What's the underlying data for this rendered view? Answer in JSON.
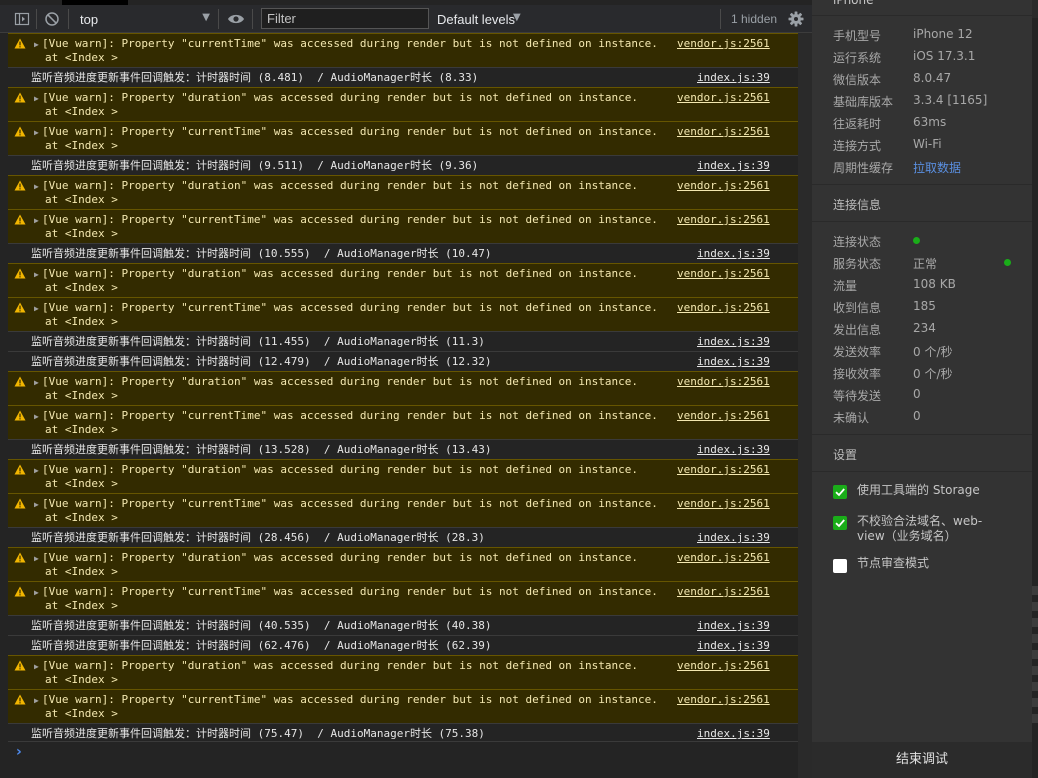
{
  "toolbar": {
    "context": "top",
    "filter_placeholder": "Filter",
    "levels": "Default levels",
    "hidden_count": "1 hidden"
  },
  "logs": [
    {
      "type": "warn",
      "l1": "[Vue warn]: Property \"currentTime\" was accessed during render but is not defined on instance.",
      "l2": "at <Index >",
      "src": "vendor.js:2561"
    },
    {
      "type": "info",
      "msg": "监听音频进度更新事件回调触发：计时器时间 (8.481)  / AudioManager时长 (8.33)",
      "src": "index.js:39"
    },
    {
      "type": "warn",
      "l1": "[Vue warn]: Property \"duration\" was accessed during render but is not defined on instance.",
      "l2": "at <Index >",
      "src": "vendor.js:2561"
    },
    {
      "type": "warn",
      "l1": "[Vue warn]: Property \"currentTime\" was accessed during render but is not defined on instance.",
      "l2": "at <Index >",
      "src": "vendor.js:2561"
    },
    {
      "type": "info",
      "msg": "监听音频进度更新事件回调触发：计时器时间 (9.511)  / AudioManager时长 (9.36)",
      "src": "index.js:39"
    },
    {
      "type": "warn",
      "l1": "[Vue warn]: Property \"duration\" was accessed during render but is not defined on instance.",
      "l2": "at <Index >",
      "src": "vendor.js:2561"
    },
    {
      "type": "warn",
      "l1": "[Vue warn]: Property \"currentTime\" was accessed during render but is not defined on instance.",
      "l2": "at <Index >",
      "src": "vendor.js:2561"
    },
    {
      "type": "info",
      "msg": "监听音频进度更新事件回调触发：计时器时间 (10.555)  / AudioManager时长 (10.47)",
      "src": "index.js:39"
    },
    {
      "type": "warn",
      "l1": "[Vue warn]: Property \"duration\" was accessed during render but is not defined on instance.",
      "l2": "at <Index >",
      "src": "vendor.js:2561"
    },
    {
      "type": "warn",
      "l1": "[Vue warn]: Property \"currentTime\" was accessed during render but is not defined on instance.",
      "l2": "at <Index >",
      "src": "vendor.js:2561"
    },
    {
      "type": "info",
      "msg": "监听音频进度更新事件回调触发：计时器时间 (11.455)  / AudioManager时长 (11.3)",
      "src": "index.js:39"
    },
    {
      "type": "info",
      "msg": "监听音频进度更新事件回调触发：计时器时间 (12.479)  / AudioManager时长 (12.32)",
      "src": "index.js:39"
    },
    {
      "type": "warn",
      "l1": "[Vue warn]: Property \"duration\" was accessed during render but is not defined on instance.",
      "l2": "at <Index >",
      "src": "vendor.js:2561"
    },
    {
      "type": "warn",
      "l1": "[Vue warn]: Property \"currentTime\" was accessed during render but is not defined on instance.",
      "l2": "at <Index >",
      "src": "vendor.js:2561"
    },
    {
      "type": "info",
      "msg": "监听音频进度更新事件回调触发：计时器时间 (13.528)  / AudioManager时长 (13.43)",
      "src": "index.js:39"
    },
    {
      "type": "warn",
      "l1": "[Vue warn]: Property \"duration\" was accessed during render but is not defined on instance.",
      "l2": "at <Index >",
      "src": "vendor.js:2561"
    },
    {
      "type": "warn",
      "l1": "[Vue warn]: Property \"currentTime\" was accessed during render but is not defined on instance.",
      "l2": "at <Index >",
      "src": "vendor.js:2561"
    },
    {
      "type": "info",
      "msg": "监听音频进度更新事件回调触发：计时器时间 (28.456)  / AudioManager时长 (28.3)",
      "src": "index.js:39"
    },
    {
      "type": "warn",
      "l1": "[Vue warn]: Property \"duration\" was accessed during render but is not defined on instance.",
      "l2": "at <Index >",
      "src": "vendor.js:2561"
    },
    {
      "type": "warn",
      "l1": "[Vue warn]: Property \"currentTime\" was accessed during render but is not defined on instance.",
      "l2": "at <Index >",
      "src": "vendor.js:2561"
    },
    {
      "type": "info",
      "msg": "监听音频进度更新事件回调触发：计时器时间 (40.535)  / AudioManager时长 (40.38)",
      "src": "index.js:39"
    },
    {
      "type": "info",
      "msg": "监听音频进度更新事件回调触发：计时器时间 (62.476)  / AudioManager时长 (62.39)",
      "src": "index.js:39"
    },
    {
      "type": "warn",
      "l1": "[Vue warn]: Property \"duration\" was accessed during render but is not defined on instance.",
      "l2": "at <Index >",
      "src": "vendor.js:2561"
    },
    {
      "type": "warn",
      "l1": "[Vue warn]: Property \"currentTime\" was accessed during render but is not defined on instance.",
      "l2": "at <Index >",
      "src": "vendor.js:2561"
    },
    {
      "type": "info",
      "msg": "监听音频进度更新事件回调触发：计时器时间 (75.47)  / AudioManager时长 (75.38)",
      "src": "index.js:39"
    }
  ],
  "prompt_symbol": "›",
  "panel": {
    "header": "iPhone",
    "device": [
      {
        "k": "手机型号",
        "v": "iPhone 12"
      },
      {
        "k": "运行系统",
        "v": "iOS 17.3.1"
      },
      {
        "k": "微信版本",
        "v": "8.0.47"
      },
      {
        "k": "基础库版本",
        "v": "3.3.4 [1165]"
      },
      {
        "k": "往返耗时",
        "v": "63ms"
      },
      {
        "k": "连接方式",
        "v": "Wi-Fi"
      },
      {
        "k": "周期性缓存",
        "v": "拉取数据",
        "link": true
      }
    ],
    "conn_title": "连接信息",
    "conn": [
      {
        "k": "连接状态",
        "v": ""
      },
      {
        "k": "服务状态",
        "v": "正常"
      },
      {
        "k": "流量",
        "v": "108 KB"
      },
      {
        "k": "收到信息",
        "v": "185"
      },
      {
        "k": "发出信息",
        "v": "234"
      },
      {
        "k": "发送效率",
        "v": "0 个/秒"
      },
      {
        "k": "接收效率",
        "v": "0 个/秒"
      },
      {
        "k": "等待发送",
        "v": "0"
      },
      {
        "k": "未确认",
        "v": "0"
      }
    ],
    "settings_title": "设置",
    "settings": [
      {
        "label": "使用工具端的 Storage",
        "checked": true
      },
      {
        "label": "不校验合法域名、web-view（业务域名）",
        "checked": true
      },
      {
        "label": "节点审查模式",
        "checked": false
      }
    ],
    "stop_button": "结束调试",
    "status_color": "#1aad19"
  }
}
